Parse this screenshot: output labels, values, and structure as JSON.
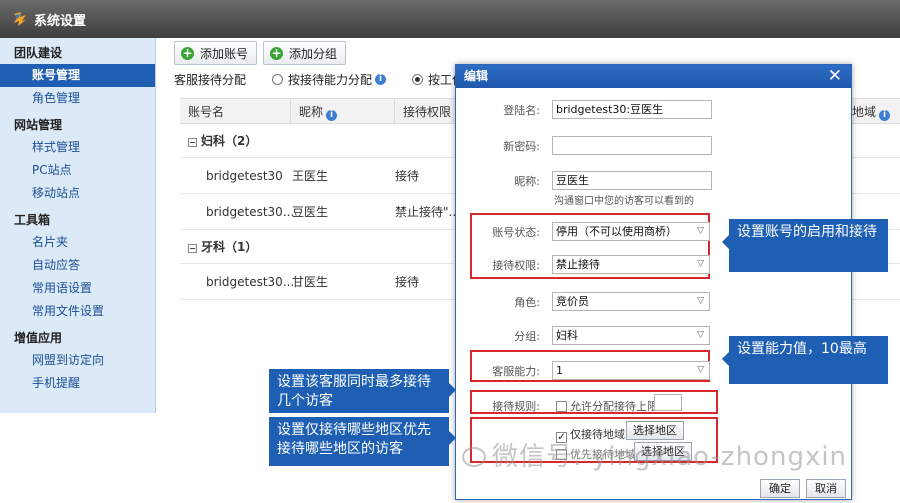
{
  "window": {
    "title": "系统设置"
  },
  "sidebar": {
    "groups": [
      {
        "label": "团队建设",
        "items": [
          "账号管理",
          "角色管理"
        ]
      },
      {
        "label": "网站管理",
        "items": [
          "样式管理",
          "PC站点",
          "移动站点"
        ]
      },
      {
        "label": "工具箱",
        "items": [
          "名片夹",
          "自动应答",
          "常用语设置",
          "常用文件设置"
        ]
      },
      {
        "label": "增值应用",
        "items": [
          "网盟到访定向",
          "手机提醒"
        ]
      }
    ],
    "active": "账号管理"
  },
  "toolbar": {
    "add_account": "添加账号",
    "add_group": "添加分组"
  },
  "allocation": {
    "label": "客服接待分配",
    "option1": "按接待能力分配",
    "option2": "按工作",
    "selected": "option2"
  },
  "table": {
    "headers": {
      "account": "账号名",
      "nickname": "昵称",
      "permission": "接待权限",
      "region": "地域"
    },
    "groups": [
      {
        "name": "妇科（2）",
        "rows": [
          {
            "account": "bridgetest30",
            "nickname": "王医生",
            "permission": "接待"
          },
          {
            "account": "bridgetest30...",
            "nickname": "豆医生",
            "permission": "禁止接待\"..."
          }
        ]
      },
      {
        "name": "牙科（1）",
        "rows": [
          {
            "account": "bridgetest30...",
            "nickname": "甘医生",
            "permission": "接待"
          }
        ]
      }
    ]
  },
  "dialog": {
    "title": "编辑",
    "close": "✕",
    "login_label": "登陆名:",
    "login_value": "bridgetest30:豆医生",
    "password_label": "新密码:",
    "password_value": "",
    "nickname_label": "昵称:",
    "nickname_value": "豆医生",
    "nickname_hint": "沟通窗口中您的访客可以看到的",
    "status_label": "账号状态:",
    "status_value": "停用（不可以使用商桥）",
    "permission_label": "接待权限:",
    "permission_value": "禁止接待",
    "role_label": "角色:",
    "role_value": "竞价员",
    "group_label": "分组:",
    "group_value": "妇科",
    "capacity_label": "客服能力:",
    "capacity_value": "1",
    "rule_label": "接待规则:",
    "rule_check": "允许分配接待上限",
    "region_check": "仅接待地域",
    "select_region": "选择地区",
    "priority_check": "优先接待地域",
    "select_region2": "选择地区",
    "ok": "确定",
    "cancel": "取消"
  },
  "callouts": {
    "status": "设置账号的启用和接待",
    "capacity": "设置能力值，10最高",
    "rule": "设置该客服同时最多接待几个访客",
    "region": "设置仅接待哪些地区优先接待哪些地区的访客"
  },
  "watermark": "微信号: yingxiao-zhongxin"
}
